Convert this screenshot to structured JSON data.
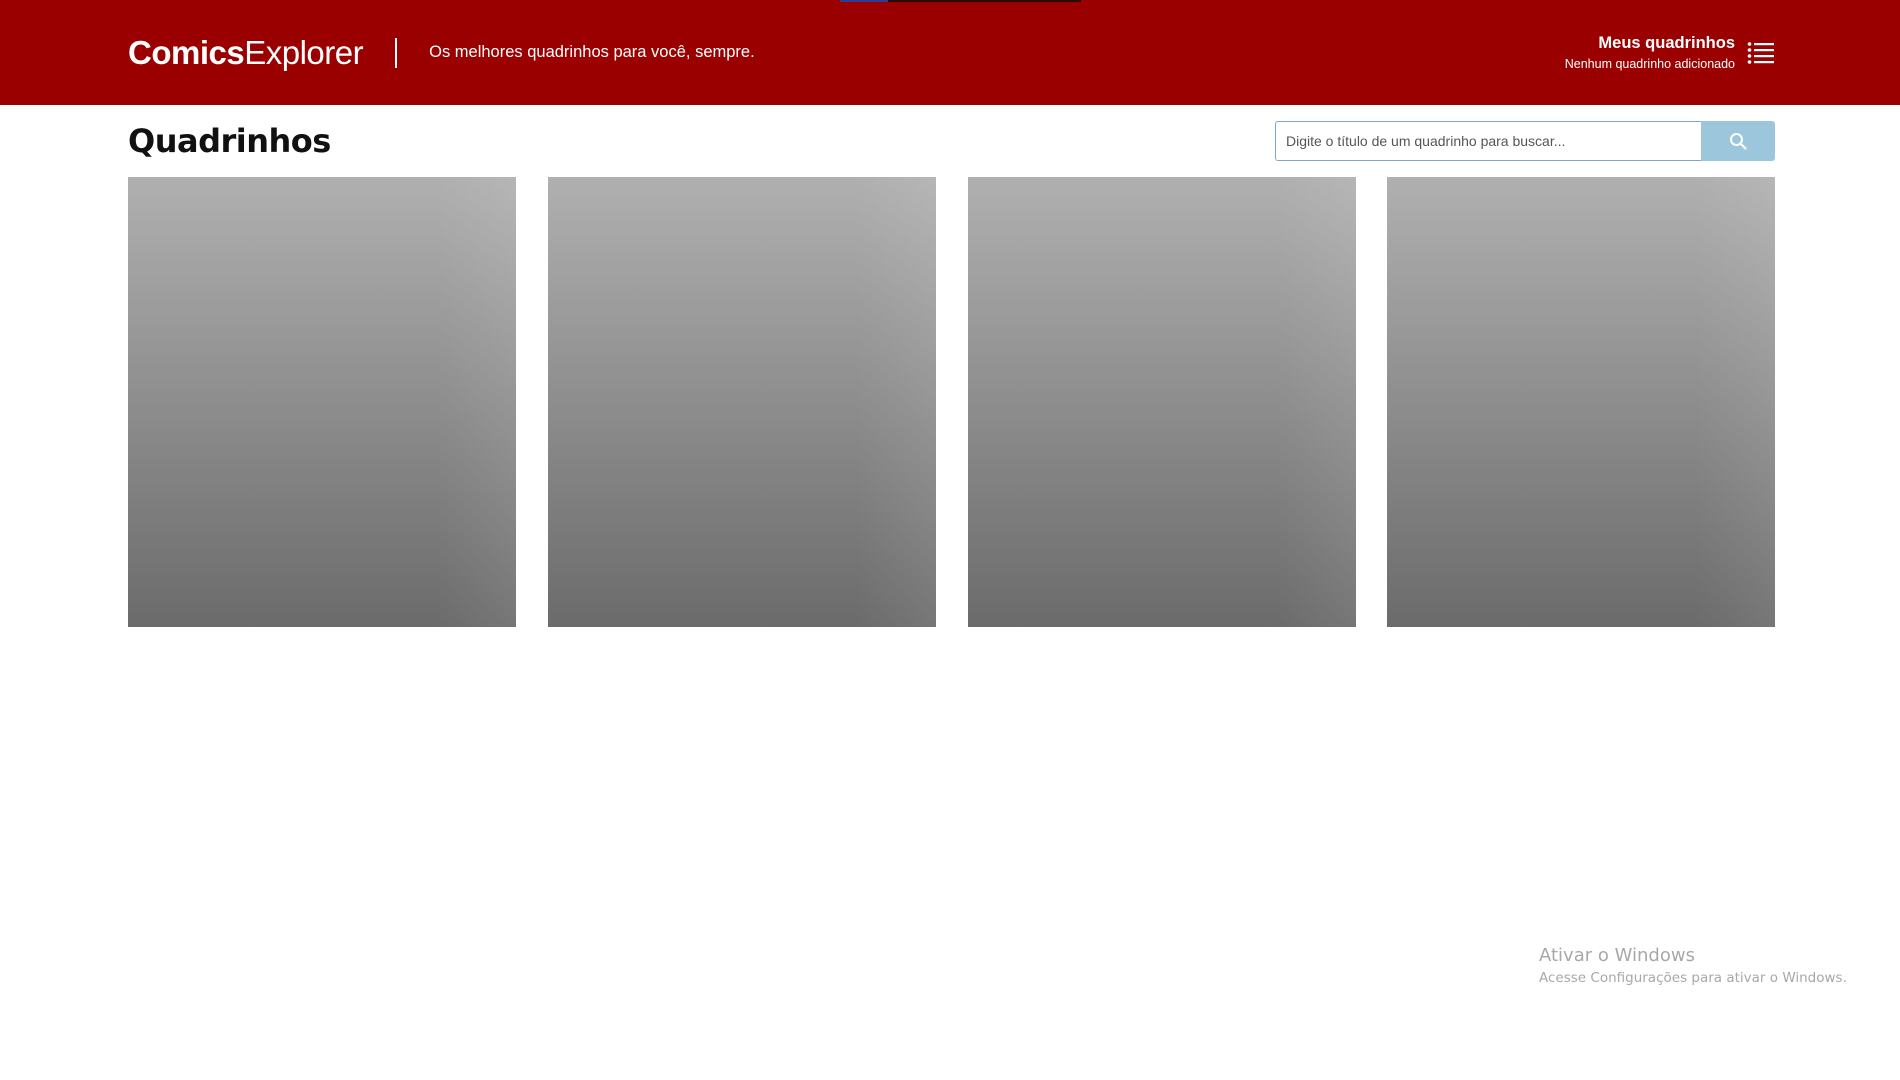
{
  "header": {
    "logo_bold": "Comics",
    "logo_light": "Explorer",
    "tagline": "Os melhores quadrinhos para você, sempre.",
    "my_comics": {
      "title": "Meus quadrinhos",
      "subtitle": "Nenhum quadrinho adicionado",
      "icon": "list-icon"
    },
    "loading_progress": 0.2
  },
  "main": {
    "title": "Quadrinhos",
    "search": {
      "placeholder": "Digite o título de um quadrinho para buscar...",
      "value": "",
      "button_icon": "search-icon"
    },
    "cards": [
      {
        "state": "loading-placeholder"
      },
      {
        "state": "loading-placeholder"
      },
      {
        "state": "loading-placeholder"
      },
      {
        "state": "loading-placeholder"
      }
    ]
  },
  "os_watermark": {
    "title": "Ativar o Windows",
    "subtitle": "Acesse Configurações para ativar o Windows."
  },
  "colors": {
    "header_bg": "#9a0000",
    "search_button_bg": "#9cc6dc",
    "search_border": "#7fa9c8",
    "card_gradient_top": "#b0b0b0",
    "card_gradient_bottom": "#6b6b6b"
  }
}
